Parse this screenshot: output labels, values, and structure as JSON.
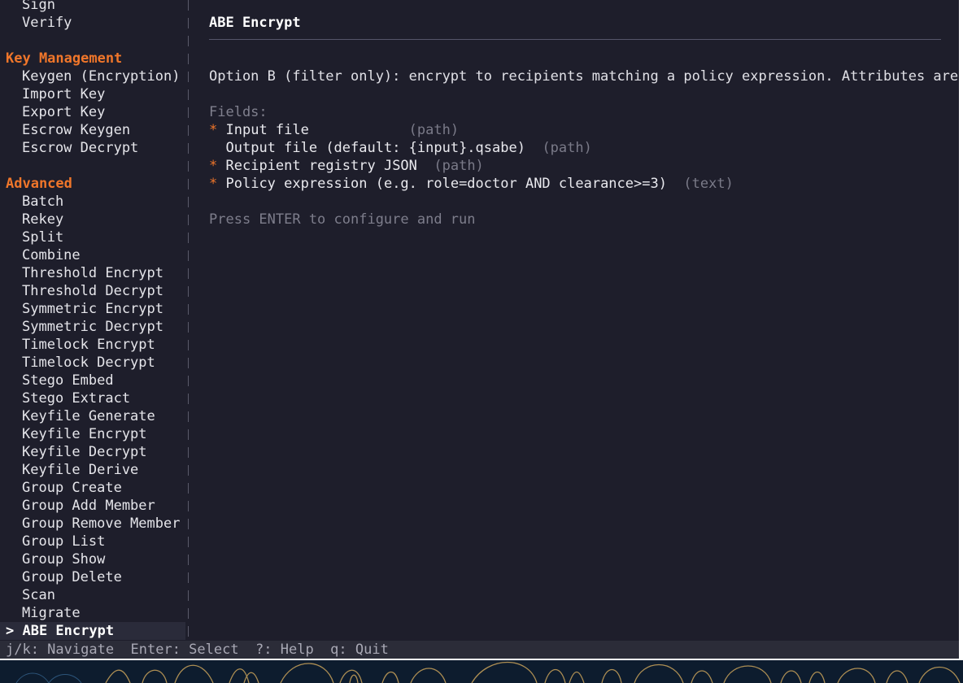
{
  "sidebar": {
    "sections": [
      {
        "type": "item",
        "label": "Sign"
      },
      {
        "type": "item",
        "label": "Verify"
      },
      {
        "type": "blank"
      },
      {
        "type": "header",
        "label": "Key Management"
      },
      {
        "type": "item",
        "label": "Keygen (Encryption)"
      },
      {
        "type": "item",
        "label": "Import Key"
      },
      {
        "type": "item",
        "label": "Export Key"
      },
      {
        "type": "item",
        "label": "Escrow Keygen"
      },
      {
        "type": "item",
        "label": "Escrow Decrypt"
      },
      {
        "type": "blank"
      },
      {
        "type": "header",
        "label": "Advanced"
      },
      {
        "type": "item",
        "label": "Batch"
      },
      {
        "type": "item",
        "label": "Rekey"
      },
      {
        "type": "item",
        "label": "Split"
      },
      {
        "type": "item",
        "label": "Combine"
      },
      {
        "type": "item",
        "label": "Threshold Encrypt"
      },
      {
        "type": "item",
        "label": "Threshold Decrypt"
      },
      {
        "type": "item",
        "label": "Symmetric Encrypt"
      },
      {
        "type": "item",
        "label": "Symmetric Decrypt"
      },
      {
        "type": "item",
        "label": "Timelock Encrypt"
      },
      {
        "type": "item",
        "label": "Timelock Decrypt"
      },
      {
        "type": "item",
        "label": "Stego Embed"
      },
      {
        "type": "item",
        "label": "Stego Extract"
      },
      {
        "type": "item",
        "label": "Keyfile Generate"
      },
      {
        "type": "item",
        "label": "Keyfile Encrypt"
      },
      {
        "type": "item",
        "label": "Keyfile Decrypt"
      },
      {
        "type": "item",
        "label": "Keyfile Derive"
      },
      {
        "type": "item",
        "label": "Group Create"
      },
      {
        "type": "item",
        "label": "Group Add Member"
      },
      {
        "type": "item",
        "label": "Group Remove Member"
      },
      {
        "type": "item",
        "label": "Group List"
      },
      {
        "type": "item",
        "label": "Group Show"
      },
      {
        "type": "item",
        "label": "Group Delete"
      },
      {
        "type": "item",
        "label": "Scan"
      },
      {
        "type": "item",
        "label": "Migrate"
      },
      {
        "type": "selected",
        "label": "> ABE Encrypt"
      }
    ]
  },
  "main": {
    "title": "ABE Encrypt",
    "description": "Option B (filter only): encrypt to recipients matching a policy expression. Attributes are N",
    "fields_label": "Fields:",
    "fields": [
      {
        "required": true,
        "marker": "*",
        "name": "Input file            ",
        "type": "(path)"
      },
      {
        "required": false,
        "marker": " ",
        "name": "Output file (default: {input}.qsabe)  ",
        "type": "(path)"
      },
      {
        "required": true,
        "marker": "*",
        "name": "Recipient registry JSON  ",
        "type": "(path)"
      },
      {
        "required": true,
        "marker": "*",
        "name": "Policy expression (e.g. role=doctor AND clearance>=3)  ",
        "type": "(text)"
      }
    ],
    "hint": "Press ENTER to configure and run"
  },
  "statusbar": {
    "text": "j/k: Navigate  Enter: Select  ?: Help  q: Quit"
  },
  "colors": {
    "background": "#1e1e2b",
    "accent": "#f0762a",
    "muted": "#7d7d8b",
    "statusbar": "#2b2c38"
  }
}
